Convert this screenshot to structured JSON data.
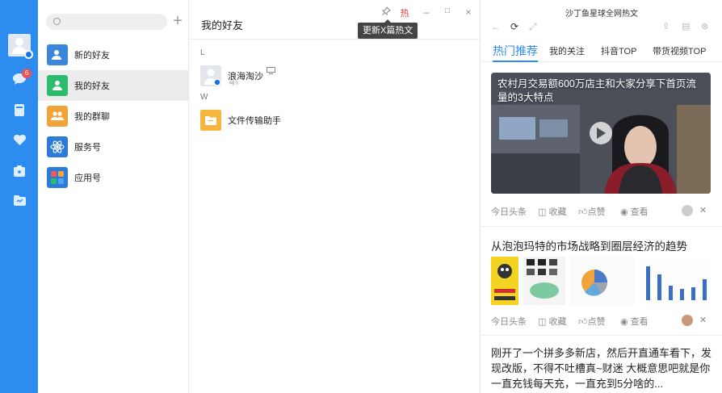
{
  "sidebar": {
    "badge_count": "6",
    "icons": [
      "avatar",
      "chat-icon",
      "contacts-book-icon",
      "favorite-icon",
      "app-box-icon",
      "folder-icon"
    ]
  },
  "contacts_nav": {
    "search_placeholder": "",
    "items": [
      {
        "label": "新的好友",
        "color": "#3b86d8"
      },
      {
        "label": "我的好友",
        "color": "#2dbb6e"
      },
      {
        "label": "我的群聊",
        "color": "#f0a43a"
      },
      {
        "label": "服务号",
        "color": "#2d7bd8"
      },
      {
        "label": "应用号",
        "color": "#2d7bd8"
      }
    ]
  },
  "friends": {
    "title": "我的好友",
    "tooltip": "更新X篇热文",
    "hot_label": "热",
    "groups": [
      {
        "letter": "L",
        "name": "浪海淘沙"
      },
      {
        "letter": "W",
        "name": "文件传输助手"
      }
    ]
  },
  "news": {
    "panel_title": "沙丁鱼星球全网热文",
    "tabs": [
      "热门推荐",
      "我的关注",
      "抖音TOP",
      "带货视频TOP"
    ],
    "articles": [
      {
        "headline": "农村月交易额600万店主和大家分享下首页流量的3大特点",
        "source": "今日头条",
        "collect": "收藏",
        "like": "点赞",
        "view": "查看"
      },
      {
        "headline": "从泡泡玛特的市场战略到圈层经济的趋势",
        "source": "今日头条",
        "collect": "收藏",
        "like": "点赞",
        "view": "查看"
      },
      {
        "headline": "刚开了一个拼多多新店，然后开直通车看下，发现改版，不得不吐槽真~财迷 大概意思吧就是你一直充钱每天充，一直充到5分啥的..."
      }
    ]
  },
  "colors": {
    "accent": "#2d8cf0",
    "rail": "#2d8cf0",
    "badge": "#f05050"
  }
}
